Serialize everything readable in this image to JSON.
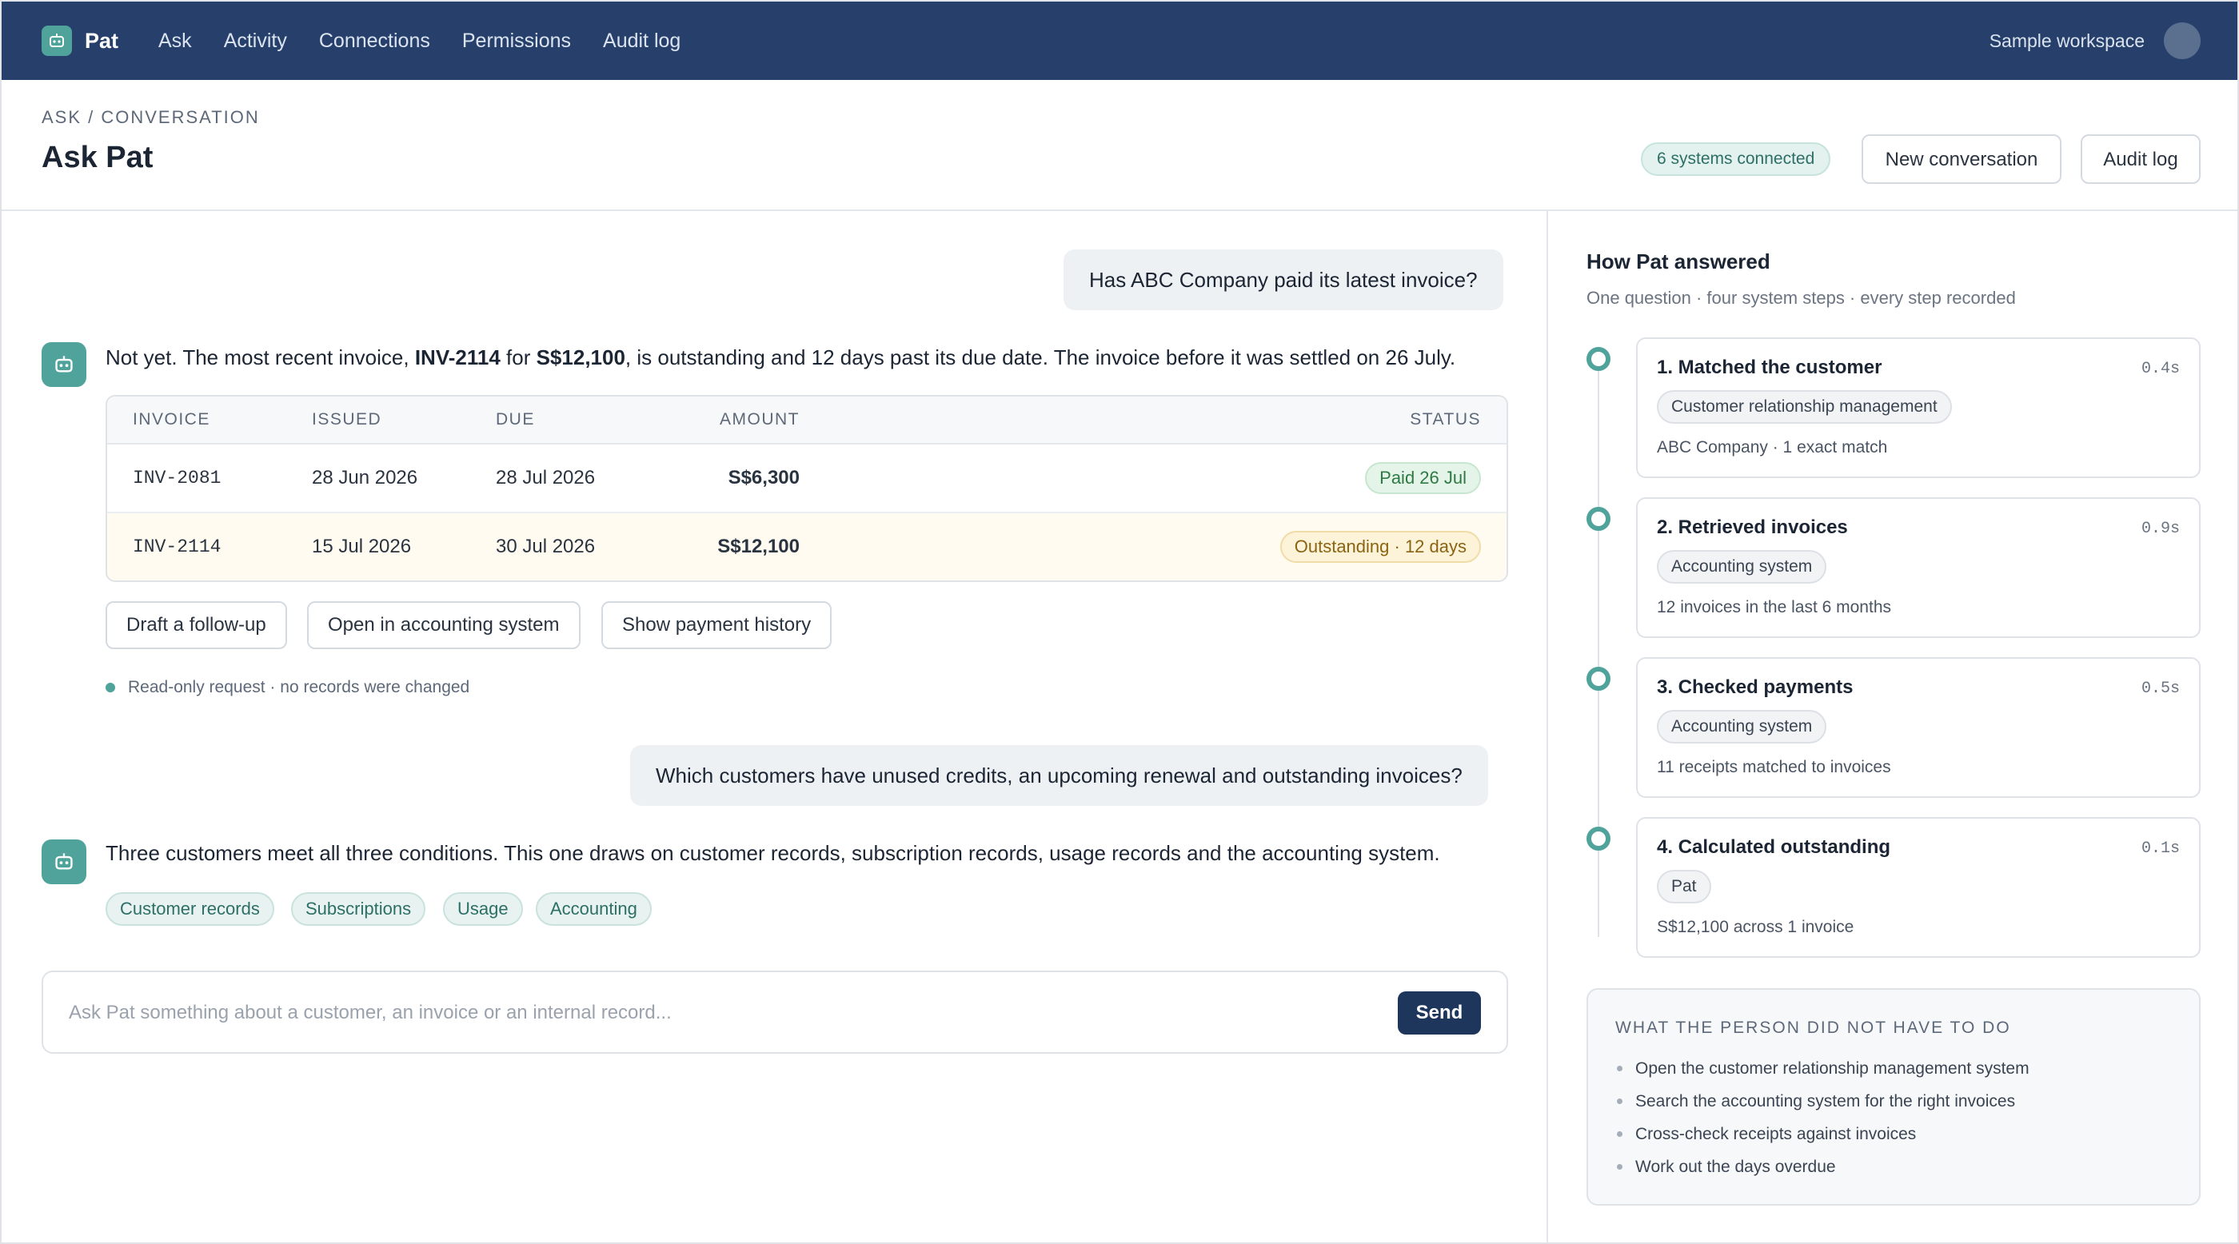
{
  "nav": {
    "brand": "Pat",
    "links": [
      "Ask",
      "Activity",
      "Connections",
      "Permissions",
      "Audit log"
    ],
    "workspace": "Sample workspace"
  },
  "header": {
    "breadcrumb": "ASK / CONVERSATION",
    "title": "Ask Pat",
    "connected_badge": "6 systems connected",
    "new_conversation": "New conversation",
    "audit_log": "Audit log"
  },
  "conversation": {
    "q1": "Has ABC Company paid its latest invoice?",
    "a1": {
      "pre": "Not yet. The most recent invoice, ",
      "invoice": "INV-2114",
      "mid": " for ",
      "amount": "S$12,100",
      "post": ", is outstanding and 12 days past its due date. The invoice before it was settled on 26 July."
    },
    "table": {
      "headers": [
        "INVOICE",
        "ISSUED",
        "DUE",
        "AMOUNT",
        "STATUS"
      ],
      "rows": [
        {
          "invoice": "INV-2081",
          "issued": "28 Jun 2026",
          "due": "28 Jul 2026",
          "amount": "S$6,300",
          "status": "Paid 26 Jul"
        },
        {
          "invoice": "INV-2114",
          "issued": "15 Jul 2026",
          "due": "30 Jul 2026",
          "amount": "S$12,100",
          "status": "Outstanding · 12 days"
        }
      ]
    },
    "actions": [
      "Draft a follow-up",
      "Open in accounting system",
      "Show payment history"
    ],
    "readonly_note": "Read-only request · no records were changed",
    "q2": "Which customers have unused credits, an upcoming renewal and outstanding invoices?",
    "a2": "Three customers meet all three conditions. This one draws on customer records, subscription records, usage records and the accounting system.",
    "sources": [
      "Customer records",
      "Subscriptions",
      "Usage",
      "Accounting"
    ]
  },
  "composer": {
    "placeholder": "Ask Pat something about a customer, an invoice or an internal record...",
    "send": "Send"
  },
  "panel": {
    "title": "How Pat answered",
    "subtitle": "One question · four system steps · every step recorded",
    "steps": [
      {
        "title": "1. Matched the customer",
        "time": "0.4s",
        "system": "Customer relationship management",
        "detail": "ABC Company · 1 exact match"
      },
      {
        "title": "2. Retrieved invoices",
        "time": "0.9s",
        "system": "Accounting system",
        "detail": "12 invoices in the last 6 months"
      },
      {
        "title": "3. Checked payments",
        "time": "0.5s",
        "system": "Accounting system",
        "detail": "11 receipts matched to invoices"
      },
      {
        "title": "4. Calculated outstanding",
        "time": "0.1s",
        "system": "Pat",
        "detail": "S$12,100 across 1 invoice"
      }
    ],
    "not_done": {
      "title": "WHAT THE PERSON DID NOT HAVE TO DO",
      "items": [
        "Open the customer relationship management system",
        "Search the accounting system for the right invoices",
        "Cross-check receipts against invoices",
        "Work out the days overdue"
      ]
    }
  },
  "colors": {
    "nav_bg": "#27406b",
    "accent": "#4fa39a",
    "send_bg": "#1e355c"
  },
  "icons": {
    "logo": "robot-icon",
    "bot_avatar": "robot-icon",
    "user": "avatar"
  }
}
